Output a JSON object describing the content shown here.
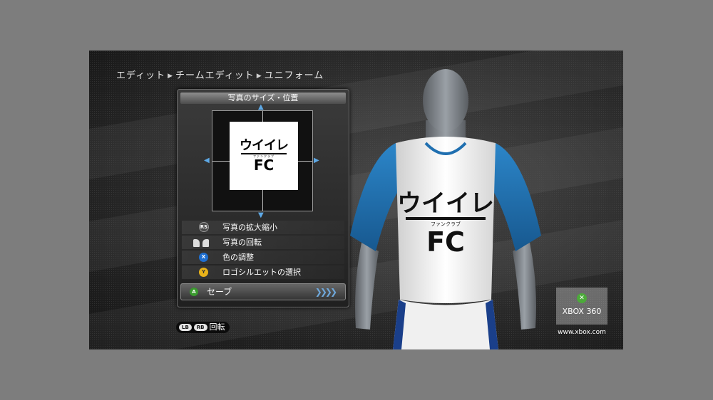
{
  "breadcrumb": {
    "items": [
      "エディット",
      "チームエディット",
      "ユニフォーム"
    ],
    "separator": "▶"
  },
  "panel": {
    "title": "写真のサイズ・位置",
    "logo": {
      "line1": "ウイイレ",
      "subtitle": "ファンクラブ",
      "line2": "FC"
    },
    "menu": [
      {
        "button": "RS",
        "label": "写真の拡大縮小"
      },
      {
        "button": "LT RT",
        "label": "写真の回転"
      },
      {
        "button": "X",
        "label": "色の調整"
      },
      {
        "button": "Y",
        "label": "ロゴシルエットの選択"
      }
    ],
    "save": {
      "button": "A",
      "label": "セーブ"
    }
  },
  "footer_hint": {
    "buttons": [
      "LB",
      "RB"
    ],
    "label": "回転"
  },
  "shirt": {
    "line1": "ウイイレ",
    "subtitle": "ファンクラブ",
    "line2": "FC"
  },
  "watermark": {
    "brand": "XBOX 360",
    "url": "www.xbox.com"
  },
  "colors": {
    "sleeve_blue": "#1f6fb0",
    "accent_blue": "#5ea9e6",
    "save_green": "#3a9a2e",
    "x_blue": "#1f6fd0",
    "y_yellow": "#e8b21a"
  }
}
